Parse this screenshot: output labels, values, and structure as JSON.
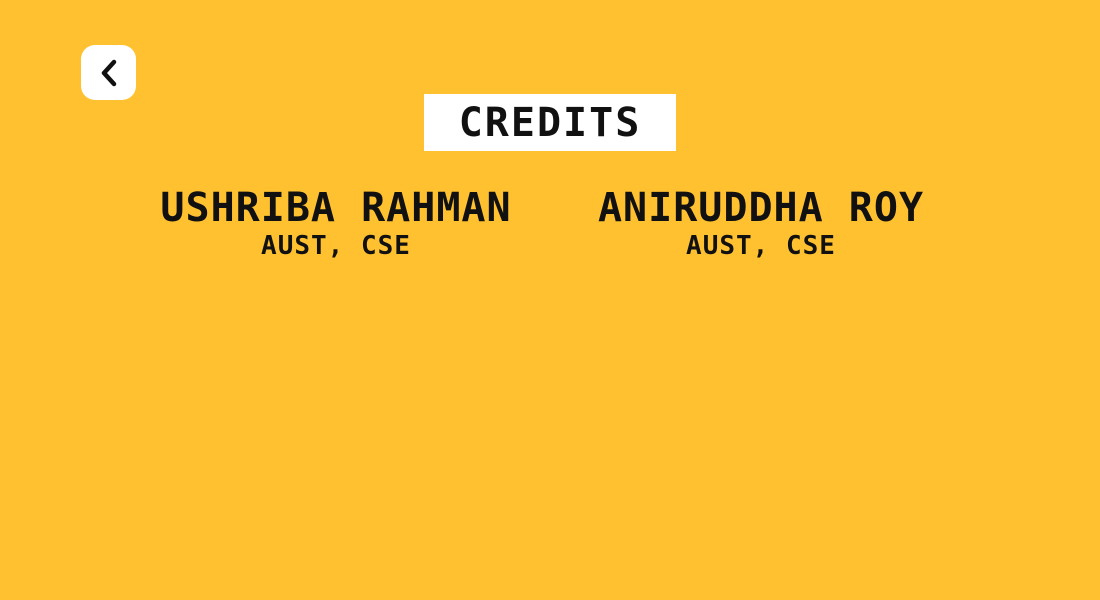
{
  "screen": {
    "background_color": "#ffc12f"
  },
  "back_button": {
    "icon": "chevron-left-icon"
  },
  "title": {
    "text": "CREDITS"
  },
  "credits": [
    {
      "name": "USHRIBA RAHMAN",
      "affiliation": "AUST, CSE"
    },
    {
      "name": "ANIRUDDHA ROY",
      "affiliation": "AUST, CSE"
    }
  ]
}
